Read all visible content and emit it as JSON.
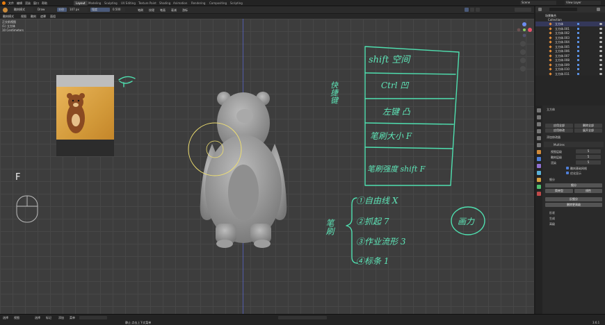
{
  "topbar": {
    "menus": [
      "文件",
      "编辑",
      "渲染",
      "窗口",
      "帮助"
    ],
    "workspace_tabs": [
      "Layout",
      "Modeling",
      "Sculpting",
      "UV Editing",
      "Texture Paint",
      "Shading",
      "Animation",
      "Rendering",
      "Compositing",
      "Scripting"
    ],
    "active_tab": "Layout",
    "scene_label": "Scene",
    "view_layer_label": "View Layer"
  },
  "header": {
    "mode": "雕刻模式",
    "brush": "Draw",
    "radius_label": "半径",
    "radius_value": "107 px",
    "strength_label": "强度",
    "strength_value": "0.500",
    "dropdowns": [
      "笔刷",
      "纹理",
      "笔画",
      "衰减",
      "游标"
    ],
    "subheader": [
      "雕刻模式",
      "视图",
      "雕刻",
      "遮罩",
      "面组"
    ]
  },
  "overlay_info": {
    "line1": "正交前视图",
    "line2": "(1) 立方体",
    "line3": "10 Centimeters"
  },
  "viewport_text": {
    "key_hint": "F"
  },
  "annotation": {
    "side_label": "快捷键",
    "table": [
      "shift 空间",
      "Ctrl 凹",
      "左键 凸",
      "笔刷大小 F",
      "笔刷强度 shift F"
    ],
    "list_label": "笔刷",
    "list": [
      "①自由线  X",
      "②抓起  7",
      "③作业流形  3",
      "④标条  1"
    ],
    "circled": "画力"
  },
  "outliner": {
    "title": "场景集合",
    "collection": "Collection",
    "items": [
      "立方体",
      "立方体.001",
      "立方体.002",
      "立方体.003",
      "立方体.004",
      "立方体.005",
      "立方体.006",
      "立方体.007",
      "立方体.008",
      "立方体.009",
      "立方体.010",
      "立方体.011"
    ]
  },
  "properties": {
    "object_name": "立方体",
    "header_buttons": [
      "应用全部",
      "删除全部",
      "应用修改",
      "展开全部"
    ],
    "add_modifier": "添加修改器",
    "modifier_name": "Multires",
    "rows": [
      {
        "label": "视图层级",
        "value": "5"
      },
      {
        "label": "雕刻层级",
        "value": "5"
      },
      {
        "label": "渲染",
        "value": "5"
      }
    ],
    "checkboxes": [
      "雕刻基础网格",
      "优化显示"
    ],
    "section_subdiv": "细分",
    "buttons": [
      "细分",
      "简单型",
      "线性",
      "反细分",
      "删除更高级"
    ],
    "sections": [
      "形状",
      "生成",
      "高级"
    ]
  },
  "bottombar": {
    "items": [
      "选择",
      "视图",
      "选择",
      "标记",
      "添加",
      "菜单"
    ],
    "status": "静止  点击上下文菜单",
    "version": "3.6.1"
  },
  "colors": {
    "accent": "#4fe0b0",
    "selection": "#34385a",
    "viewport": "#3d3d3d"
  }
}
